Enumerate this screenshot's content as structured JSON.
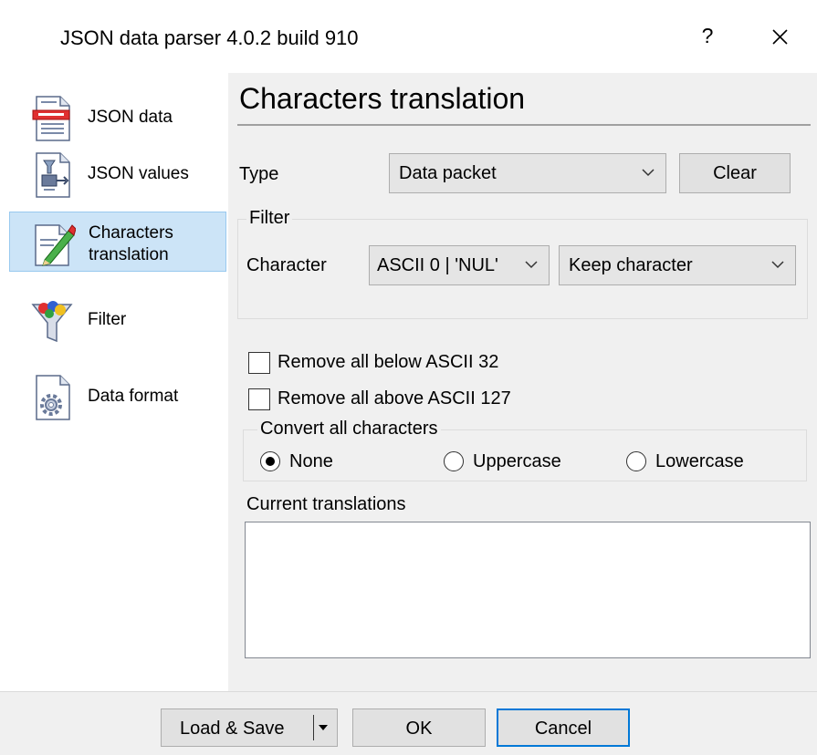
{
  "window": {
    "title": "JSON data parser 4.0.2 build 910",
    "help_label": "?"
  },
  "sidebar": {
    "items": [
      {
        "label": "JSON data"
      },
      {
        "label": "JSON values"
      },
      {
        "label": "Characters translation",
        "line1": "Characters",
        "line2": "translation",
        "selected": true
      },
      {
        "label": "Filter"
      },
      {
        "label": "Data format"
      }
    ]
  },
  "main": {
    "title": "Characters translation",
    "type_label": "Type",
    "type_value": "Data packet",
    "clear_label": "Clear",
    "filter": {
      "group_title": "Filter",
      "character_label": "Character",
      "character_value": "ASCII 0 | 'NUL'",
      "action_value": "Keep character"
    },
    "remove_below_label": "Remove all below ASCII 32",
    "remove_below_checked": false,
    "remove_above_label": "Remove all above ASCII 127",
    "remove_above_checked": false,
    "convert": {
      "group_title": "Convert all characters",
      "options": [
        {
          "label": "None",
          "selected": true
        },
        {
          "label": "Uppercase",
          "selected": false
        },
        {
          "label": "Lowercase",
          "selected": false
        }
      ]
    },
    "translations_label": "Current translations",
    "translations": []
  },
  "footer": {
    "load_save_label": "Load & Save",
    "ok_label": "OK",
    "cancel_label": "Cancel"
  },
  "colors": {
    "selection_bg": "#cce4f7",
    "selection_border": "#99c9ef",
    "default_button_border": "#0078d7",
    "dialog_bg": "#f0f0f0"
  }
}
